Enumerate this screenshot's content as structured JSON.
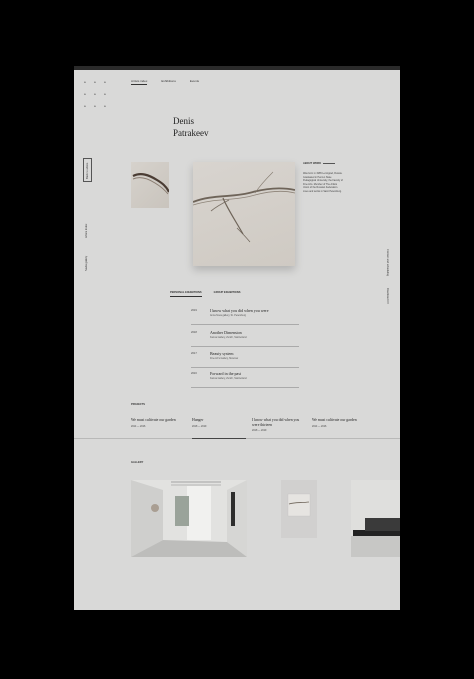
{
  "logo": {
    "letters": [
      "a",
      "a",
      "a",
      "a",
      "a",
      "a",
      "a",
      "a",
      "a"
    ]
  },
  "nav": {
    "items": [
      "Artists index",
      "Exhibitions",
      "Events"
    ]
  },
  "artist": {
    "first_name": "Denis",
    "last_name": "Patrakeev"
  },
  "side": {
    "button_label": "Back to artists",
    "label_a": "Artists Index",
    "label_b": "Nadia gallery",
    "right_a": "Contact and scheduling",
    "right_b": "Download CV"
  },
  "about": {
    "label": "ABOUT WORK",
    "text": "Was born in 1985 Leningrad, Russia. Graduated in Herzen State Pedagogical University, the Faculty of Fine Arts. Member of The Artists Union of the Russian Federation. Lives and works in Saint Petersburg."
  },
  "tabs": {
    "personal": "PERSONAL EXHIBITIONS",
    "group": "GROUP EXHIBITIONS"
  },
  "exhibitions": [
    {
      "year": "2019",
      "title": "I know what you did when you were",
      "venue": "Anna Nova gallery, St. Petersburg"
    },
    {
      "year": "2018",
      "title": "Another Dimension",
      "venue": "Kanna Gallery, Zurich, Switzerland"
    },
    {
      "year": "2017",
      "title": "Beauty system",
      "venue": "Fine Art's Gallery, Moscow"
    },
    {
      "year": "2016",
      "title": "Forward in the past",
      "venue": "Kanna Gallery, Zurich, Switzerland"
    }
  ],
  "projects": {
    "label": "PROJECTS",
    "items": [
      {
        "title": "We must cultivate our garden",
        "date": "2014 — 2016"
      },
      {
        "title": "Hunger",
        "date": "2018 — 2019"
      },
      {
        "title": "I know what you did when you were thirteen",
        "date": "2018 — 2019"
      },
      {
        "title": "We must cultivate our garden",
        "date": "2014 — 2016"
      }
    ]
  },
  "gallery": {
    "label": "GALLERY"
  },
  "colors": {
    "page_bg": "#d9d9d8",
    "frame": "#000000",
    "accent": "#333333"
  }
}
